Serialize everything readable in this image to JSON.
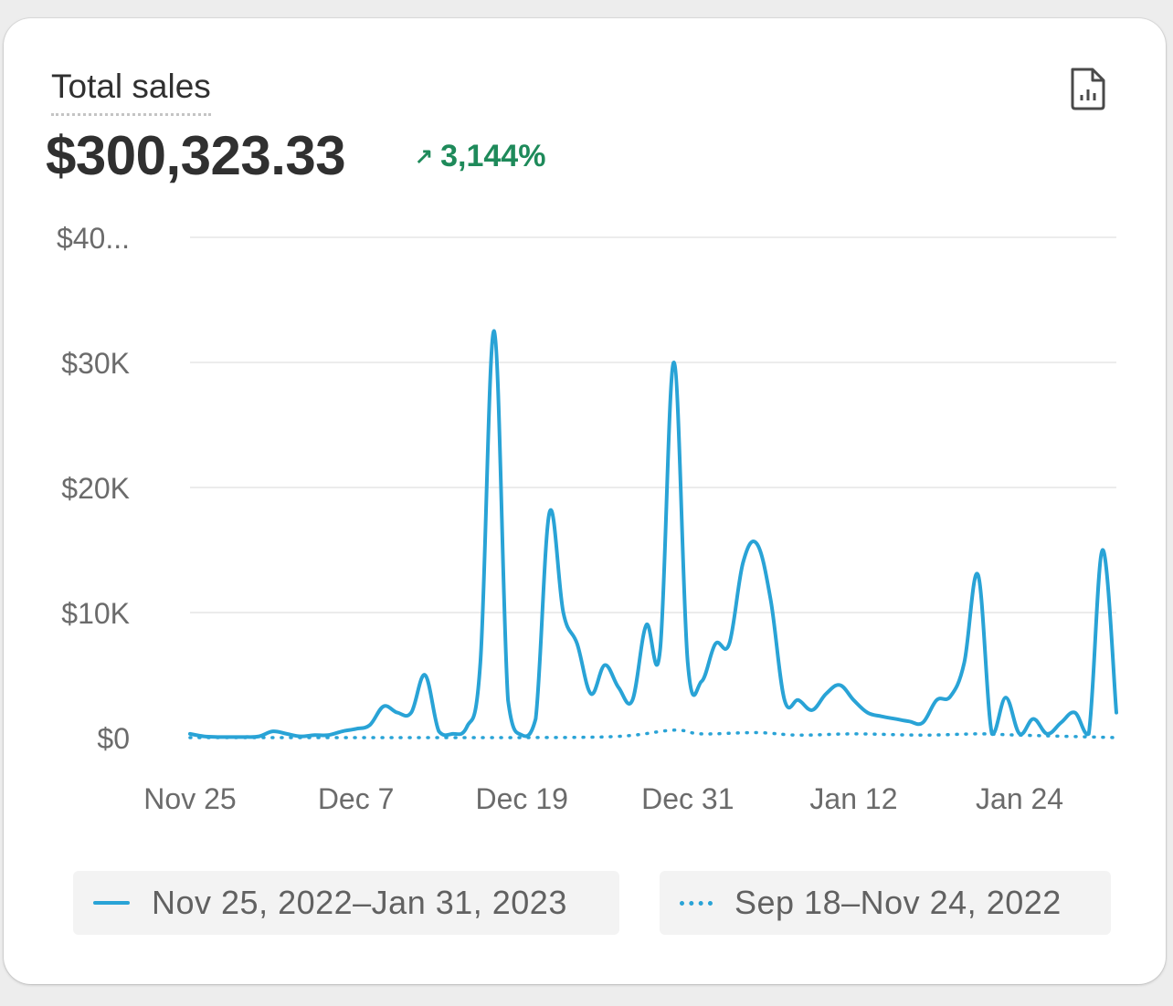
{
  "card": {
    "title": "Total sales",
    "total": "$300,323.33",
    "change_arrow": "↗",
    "change_value": "3,144%",
    "change_color": "#1e8a5a",
    "icon": "report-document-icon"
  },
  "chart_data": {
    "type": "line",
    "title": "Total sales",
    "xlabel": "",
    "ylabel": "",
    "x_ticks": [
      "Nov 25",
      "Dec 7",
      "Dec 19",
      "Dec 31",
      "Jan 12",
      "Jan 24"
    ],
    "x_start": "Nov 25, 2022",
    "x_end": "Jan 31, 2023",
    "y_ticks": [
      "$0",
      "$10K",
      "$20K",
      "$30K",
      "$40..."
    ],
    "ylim": [
      0,
      40000
    ],
    "grid": true,
    "series": [
      {
        "name": "Nov 25, 2022–Jan 31, 2023",
        "style": "solid",
        "color": "#29a3d6",
        "points": [
          {
            "x": "Nov 25",
            "y": 300
          },
          {
            "x": "Nov 26",
            "y": 100
          },
          {
            "x": "Nov 27",
            "y": 50
          },
          {
            "x": "Nov 28",
            "y": 50
          },
          {
            "x": "Nov 29",
            "y": 50
          },
          {
            "x": "Nov 30",
            "y": 100
          },
          {
            "x": "Dec 1",
            "y": 500
          },
          {
            "x": "Dec 2",
            "y": 300
          },
          {
            "x": "Dec 3",
            "y": 100
          },
          {
            "x": "Dec 4",
            "y": 200
          },
          {
            "x": "Dec 5",
            "y": 200
          },
          {
            "x": "Dec 6",
            "y": 500
          },
          {
            "x": "Dec 7",
            "y": 700
          },
          {
            "x": "Dec 8",
            "y": 1000
          },
          {
            "x": "Dec 9",
            "y": 2500
          },
          {
            "x": "Dec 10",
            "y": 2000
          },
          {
            "x": "Dec 11",
            "y": 2000
          },
          {
            "x": "Dec 12",
            "y": 5000
          },
          {
            "x": "Dec 13",
            "y": 500
          },
          {
            "x": "Dec 14",
            "y": 300
          },
          {
            "x": "Dec 15",
            "y": 800
          },
          {
            "x": "Dec 16",
            "y": 6000
          },
          {
            "x": "Dec 17",
            "y": 32500
          },
          {
            "x": "Dec 18",
            "y": 3000
          },
          {
            "x": "Dec 19",
            "y": 200
          },
          {
            "x": "Dec 20",
            "y": 1500
          },
          {
            "x": "Dec 21",
            "y": 18000
          },
          {
            "x": "Dec 22",
            "y": 10000
          },
          {
            "x": "Dec 23",
            "y": 7500
          },
          {
            "x": "Dec 24",
            "y": 3500
          },
          {
            "x": "Dec 25",
            "y": 5800
          },
          {
            "x": "Dec 26",
            "y": 4000
          },
          {
            "x": "Dec 27",
            "y": 3000
          },
          {
            "x": "Dec 28",
            "y": 9000
          },
          {
            "x": "Dec 29",
            "y": 7000
          },
          {
            "x": "Dec 30",
            "y": 30000
          },
          {
            "x": "Dec 31",
            "y": 6000
          },
          {
            "x": "Jan 1",
            "y": 4500
          },
          {
            "x": "Jan 2",
            "y": 7500
          },
          {
            "x": "Jan 3",
            "y": 7500
          },
          {
            "x": "Jan 4",
            "y": 14000
          },
          {
            "x": "Jan 5",
            "y": 15500
          },
          {
            "x": "Jan 6",
            "y": 11000
          },
          {
            "x": "Jan 7",
            "y": 3000
          },
          {
            "x": "Jan 8",
            "y": 3000
          },
          {
            "x": "Jan 9",
            "y": 2200
          },
          {
            "x": "Jan 10",
            "y": 3500
          },
          {
            "x": "Jan 11",
            "y": 4200
          },
          {
            "x": "Jan 12",
            "y": 3000
          },
          {
            "x": "Jan 13",
            "y": 2000
          },
          {
            "x": "Jan 14",
            "y": 1700
          },
          {
            "x": "Jan 15",
            "y": 1500
          },
          {
            "x": "Jan 16",
            "y": 1300
          },
          {
            "x": "Jan 17",
            "y": 1200
          },
          {
            "x": "Jan 18",
            "y": 3000
          },
          {
            "x": "Jan 19",
            "y": 3300
          },
          {
            "x": "Jan 20",
            "y": 6000
          },
          {
            "x": "Jan 21",
            "y": 13000
          },
          {
            "x": "Jan 22",
            "y": 300
          },
          {
            "x": "Jan 23",
            "y": 3200
          },
          {
            "x": "Jan 24",
            "y": 300
          },
          {
            "x": "Jan 25",
            "y": 1500
          },
          {
            "x": "Jan 26",
            "y": 300
          },
          {
            "x": "Jan 27",
            "y": 1200
          },
          {
            "x": "Jan 28",
            "y": 2000
          },
          {
            "x": "Jan 29",
            "y": 300
          },
          {
            "x": "Jan 30",
            "y": 15000
          },
          {
            "x": "Jan 31",
            "y": 2000
          }
        ]
      },
      {
        "name": "Sep 18–Nov 24, 2022",
        "style": "dotted",
        "color": "#29a3d6",
        "points": [
          {
            "x": "Nov 25",
            "y": 0
          },
          {
            "x": "Dec 7",
            "y": 0
          },
          {
            "x": "Dec 19",
            "y": 0
          },
          {
            "x": "Dec 26",
            "y": 100
          },
          {
            "x": "Dec 30",
            "y": 600
          },
          {
            "x": "Jan 1",
            "y": 300
          },
          {
            "x": "Jan 5",
            "y": 400
          },
          {
            "x": "Jan 8",
            "y": 200
          },
          {
            "x": "Jan 12",
            "y": 300
          },
          {
            "x": "Jan 17",
            "y": 200
          },
          {
            "x": "Jan 21",
            "y": 300
          },
          {
            "x": "Jan 24",
            "y": 200
          },
          {
            "x": "Jan 31",
            "y": 0
          }
        ]
      }
    ],
    "legend": [
      {
        "label": "Nov 25, 2022–Jan 31, 2023",
        "style": "solid"
      },
      {
        "label": "Sep 18–Nov 24, 2022",
        "style": "dotted"
      }
    ],
    "legend_position": "bottom"
  }
}
